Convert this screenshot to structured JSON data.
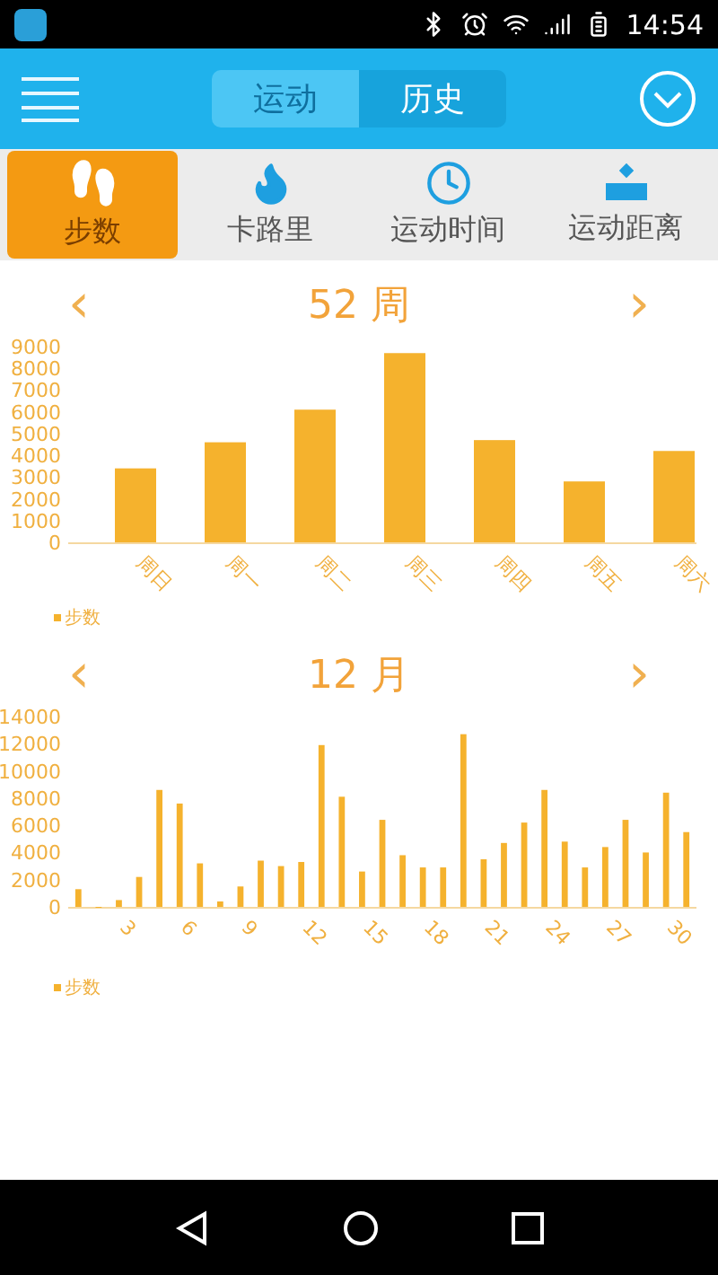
{
  "status_bar": {
    "time": "14:54"
  },
  "header": {
    "segments": [
      {
        "label": "运动",
        "selected": false
      },
      {
        "label": "历史",
        "selected": true
      }
    ]
  },
  "metric_tabs": [
    {
      "label": "步数",
      "kind": "steps",
      "selected": true
    },
    {
      "label": "卡路里",
      "kind": "calories",
      "selected": false
    },
    {
      "label": "运动时间",
      "kind": "time",
      "selected": false
    },
    {
      "label": "运动距离",
      "kind": "distance",
      "selected": false
    }
  ],
  "panels": [
    {
      "title": "52 周",
      "prev": "‹",
      "next": "›",
      "chart_data": {
        "type": "bar",
        "categories": [
          "周日",
          "周一",
          "周二",
          "周三",
          "周四",
          "周五",
          "周六"
        ],
        "ylim": [
          0,
          9000
        ],
        "yticks": [
          0,
          1000,
          2000,
          3000,
          4000,
          5000,
          6000,
          7000,
          8000,
          9000
        ],
        "series": [
          {
            "name": "步数",
            "color": "#f5b22d",
            "values": [
              3400,
              4600,
              6100,
              8700,
              4700,
              2800,
              4200
            ]
          }
        ]
      }
    },
    {
      "title": "12 月",
      "prev": "‹",
      "next": "›",
      "chart_data": {
        "type": "bar",
        "x": [
          1,
          2,
          3,
          4,
          5,
          6,
          7,
          8,
          9,
          10,
          11,
          12,
          13,
          14,
          15,
          16,
          17,
          18,
          19,
          20,
          21,
          22,
          23,
          24,
          25,
          26,
          27,
          28,
          29,
          30,
          31
        ],
        "xlim": [
          0.5,
          31.5
        ],
        "xticks": [
          3,
          6,
          9,
          12,
          15,
          18,
          21,
          24,
          27,
          30
        ],
        "ylim": [
          0,
          14000
        ],
        "yticks": [
          0,
          2000,
          4000,
          6000,
          8000,
          10000,
          12000,
          14000
        ],
        "series": [
          {
            "name": "步数",
            "color": "#f5b22d",
            "values": [
              1300,
              0,
              500,
              2200,
              8600,
              7600,
              3200,
              400,
              1500,
              3400,
              3000,
              3300,
              11900,
              8100,
              2600,
              6400,
              3800,
              2900,
              2900,
              12700,
              3500,
              4700,
              6200,
              8600,
              4800,
              2900,
              4400,
              6400,
              4000,
              8400,
              5500
            ]
          }
        ]
      }
    }
  ]
}
